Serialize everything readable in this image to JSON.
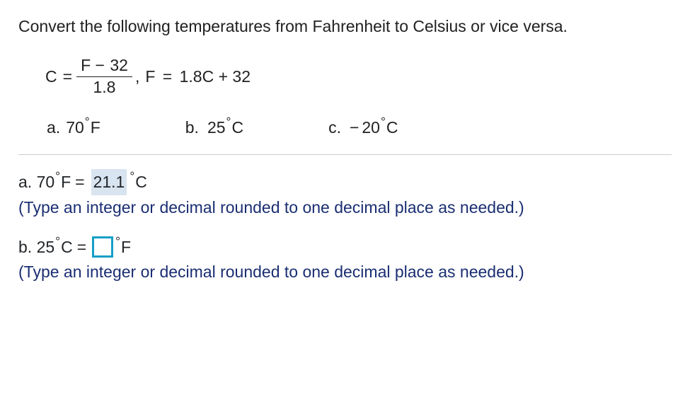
{
  "question": "Convert the following temperatures from Fahrenheit to Celsius or vice versa.",
  "formula": {
    "c_label": "C",
    "equals": "=",
    "numerator_f": "F",
    "numerator_minus": "−",
    "numerator_const": "32",
    "denominator": "1.8",
    "comma": ",",
    "f_formula_f": "F",
    "f_formula_eq": "=",
    "f_formula_rhs": "1.8C + 32"
  },
  "options": {
    "a": {
      "letter": "a.",
      "value": "70",
      "unit": "F"
    },
    "b": {
      "letter": "b.",
      "value": "25",
      "unit": "C"
    },
    "c": {
      "letter": "c.",
      "minus": "−",
      "value": "20",
      "unit": "C"
    }
  },
  "answers": {
    "a": {
      "prefix": "a. 70",
      "prefix_unit": "F",
      "equals": "=",
      "value": "21.1",
      "result_unit": "C",
      "instruction": "(Type an integer or decimal rounded to one decimal place as needed.)"
    },
    "b": {
      "prefix": "b. 25",
      "prefix_unit": "C",
      "equals": "=",
      "result_unit": "F",
      "instruction": "(Type an integer or decimal rounded to one decimal place as needed.)"
    }
  },
  "degree": "°"
}
